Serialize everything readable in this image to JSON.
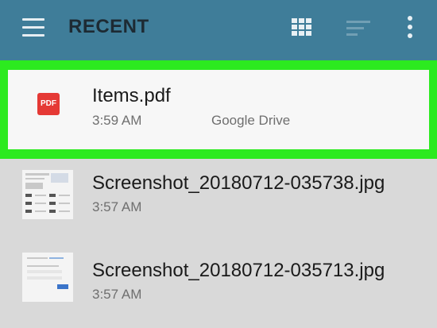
{
  "header": {
    "title": "RECENT",
    "menu_icon": "hamburger-menu-icon",
    "grid_icon": "grid-view-icon",
    "sort_icon": "sort-icon",
    "more_icon": "more-vert-icon",
    "bar_color": "#3f7d99"
  },
  "files": [
    {
      "name": "Items.pdf",
      "time": "3:59 AM",
      "source": "Google Drive",
      "icon": "pdf-icon",
      "icon_text": "PDF",
      "selected": true
    },
    {
      "name": "Screenshot_20180712-035738.jpg",
      "time": "3:57 AM",
      "icon": "image-thumbnail"
    },
    {
      "name": "Screenshot_20180712-035713.jpg",
      "time": "3:57 AM",
      "icon": "image-thumbnail"
    }
  ],
  "colors": {
    "selection_highlight": "#2cea1f",
    "pdf_red": "#e53935",
    "list_background": "#d9d9d9"
  }
}
